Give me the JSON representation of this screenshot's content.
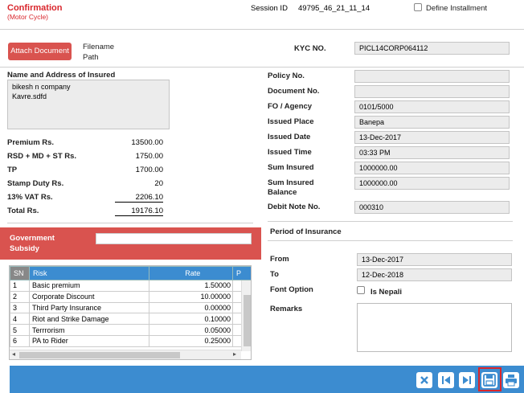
{
  "header": {
    "title": "Confirmation",
    "subtitle": "(Motor Cycle)",
    "session_label": "Session ID",
    "session_value": "49795_46_21_11_14",
    "define_installment": "Define Installment"
  },
  "attach": {
    "button": "Attach Document",
    "filename_label": "Filename",
    "path_label": "Path"
  },
  "kyc": {
    "label": "KYC NO.",
    "value": "PICL14CORP064112"
  },
  "insured": {
    "label": "Name and Address of Insured",
    "line1": "bikesh n company",
    "line2": "Kavre.sdfd"
  },
  "amounts": [
    {
      "label": "Premium Rs.",
      "value": "13500.00"
    },
    {
      "label": "RSD + MD + ST Rs.",
      "value": "1750.00"
    },
    {
      "label": "TP",
      "value": "1700.00"
    },
    {
      "label": "Stamp Duty Rs.",
      "value": "20"
    },
    {
      "label": "13% VAT Rs.",
      "value": "2206.10"
    },
    {
      "label": "Total Rs.",
      "value": "19176.10"
    }
  ],
  "policy": [
    {
      "label": "Policy No.",
      "value": ""
    },
    {
      "label": "Document No.",
      "value": ""
    },
    {
      "label": "FO / Agency",
      "value": "0101/5000"
    },
    {
      "label": "Issued Place",
      "value": "Banepa"
    },
    {
      "label": "Issued Date",
      "value": "13-Dec-2017"
    },
    {
      "label": "Issued Time",
      "value": "03:33 PM"
    },
    {
      "label": "Sum Insured",
      "value": "1000000.00"
    },
    {
      "label": "Sum Insured Balance",
      "value": "1000000.00"
    },
    {
      "label": "Debit Note No.",
      "value": "000310"
    }
  ],
  "subsidy": {
    "label": "Government Subsidy",
    "value": ""
  },
  "risk_table": {
    "headers": [
      "SN",
      "Risk",
      "Rate",
      "P"
    ],
    "rows": [
      [
        "1",
        "Basic premium",
        "1.50000"
      ],
      [
        "2",
        "Corporate Discount",
        "10.00000"
      ],
      [
        "3",
        "Third Party Insurance",
        "0.00000"
      ],
      [
        "4",
        "Riot and Strike Damage",
        "0.10000"
      ],
      [
        "5",
        "Terrrorism",
        "0.05000"
      ],
      [
        "6",
        "PA to Rider",
        "0.25000"
      ]
    ]
  },
  "period": {
    "title": "Period of Insurance",
    "from_label": "From",
    "from_value": "13-Dec-2017",
    "to_label": "To",
    "to_value": "12-Dec-2018",
    "font_label": "Font Option",
    "nepali_label": "Is Nepali",
    "remarks_label": "Remarks"
  },
  "toolbar": {
    "icons": [
      "close-icon",
      "first-page-icon",
      "last-page-icon",
      "save-icon",
      "print-icon"
    ],
    "highlight_color": "#d9262c",
    "bar_color": "#3c8cd0"
  }
}
